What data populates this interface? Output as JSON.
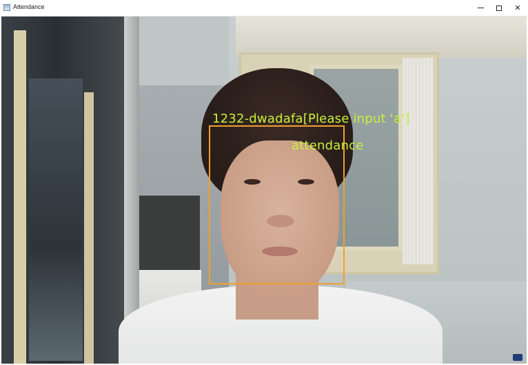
{
  "window": {
    "title": "Attendance",
    "icon": "app-window-icon",
    "controls": {
      "minimize": "minimize-icon",
      "maximize": "maximize-icon",
      "close_glyph": "✕"
    }
  },
  "overlay": {
    "id_label": "1232-dwadafa[Please input 'a']",
    "status_label": "attendance",
    "box_color": "#f0a030",
    "text_color": "#c8f03c"
  }
}
